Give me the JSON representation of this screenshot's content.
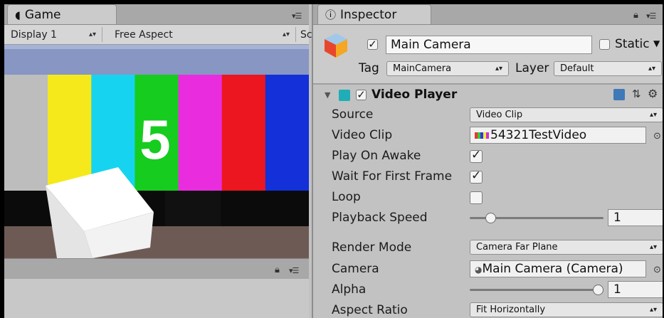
{
  "game_panel": {
    "tab_label": "Game",
    "display_select": "Display 1",
    "aspect_select": "Free Aspect",
    "scale_label_partial": "Sc",
    "countdown_number": "5",
    "colors": {
      "bars": [
        "#bdbdbd",
        "#f5e91b",
        "#16d4f0",
        "#16cc1e",
        "#ea2cdf",
        "#ec1620",
        "#1330d9"
      ],
      "sky": "#8796c2",
      "floor": "#6e5a55"
    }
  },
  "inspector": {
    "tab_label": "Inspector",
    "object_name": "Main Camera",
    "static_label": "Static",
    "tag_label": "Tag",
    "tag_value": "MainCamera",
    "layer_label": "Layer",
    "layer_value": "Default",
    "component": {
      "title": "Video Player",
      "rows": {
        "source": {
          "label": "Source",
          "value": "Video Clip"
        },
        "video_clip": {
          "label": "Video Clip",
          "value": "54321TestVideo"
        },
        "play_on_awake": {
          "label": "Play On Awake",
          "checked": true
        },
        "wait_first_frame": {
          "label": "Wait For First Frame",
          "checked": true
        },
        "loop": {
          "label": "Loop",
          "checked": false
        },
        "playback_speed": {
          "label": "Playback Speed",
          "value": "1",
          "fraction": 0.13
        },
        "render_mode": {
          "label": "Render Mode",
          "value": "Camera Far Plane"
        },
        "camera": {
          "label": "Camera",
          "value": "Main Camera (Camera)"
        },
        "alpha": {
          "label": "Alpha",
          "value": "1",
          "fraction": 1.0
        },
        "aspect_ratio": {
          "label": "Aspect Ratio",
          "value": "Fit Horizontally"
        }
      }
    }
  }
}
